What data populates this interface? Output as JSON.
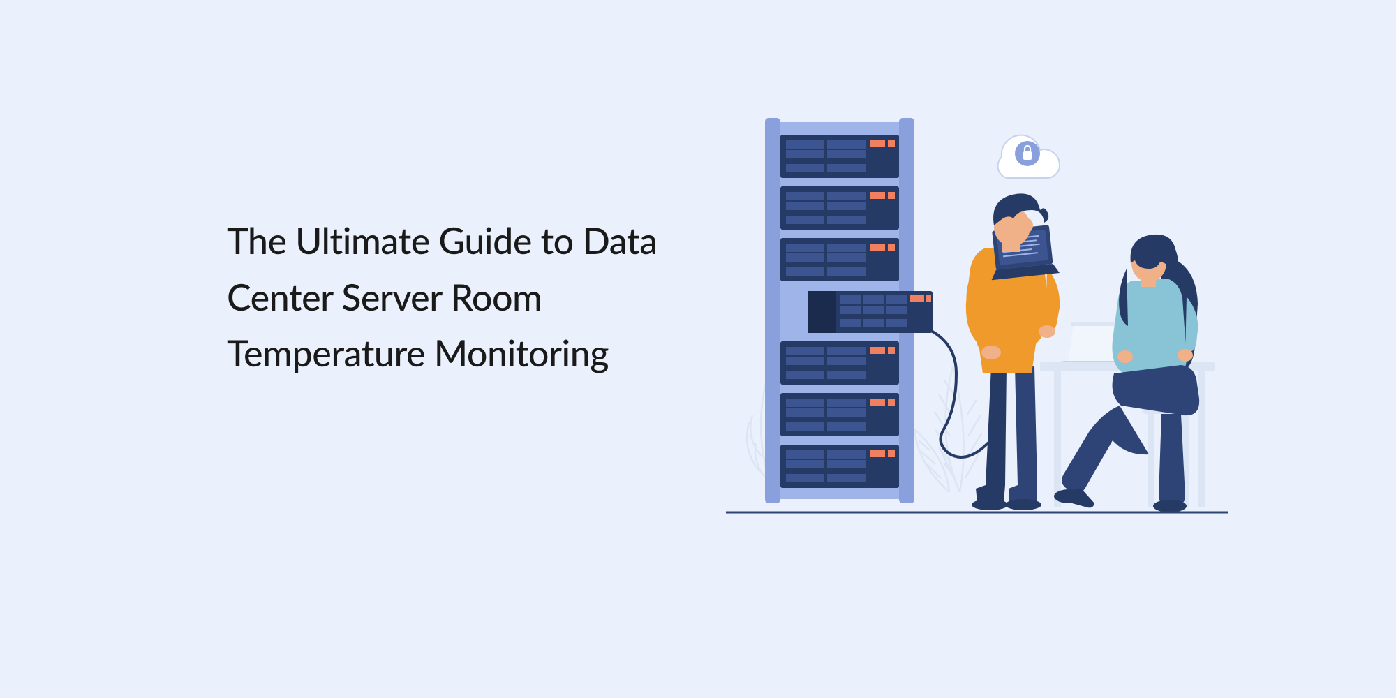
{
  "title": "The Ultimate Guide to Data Center Server Room Temperature Monitoring"
}
